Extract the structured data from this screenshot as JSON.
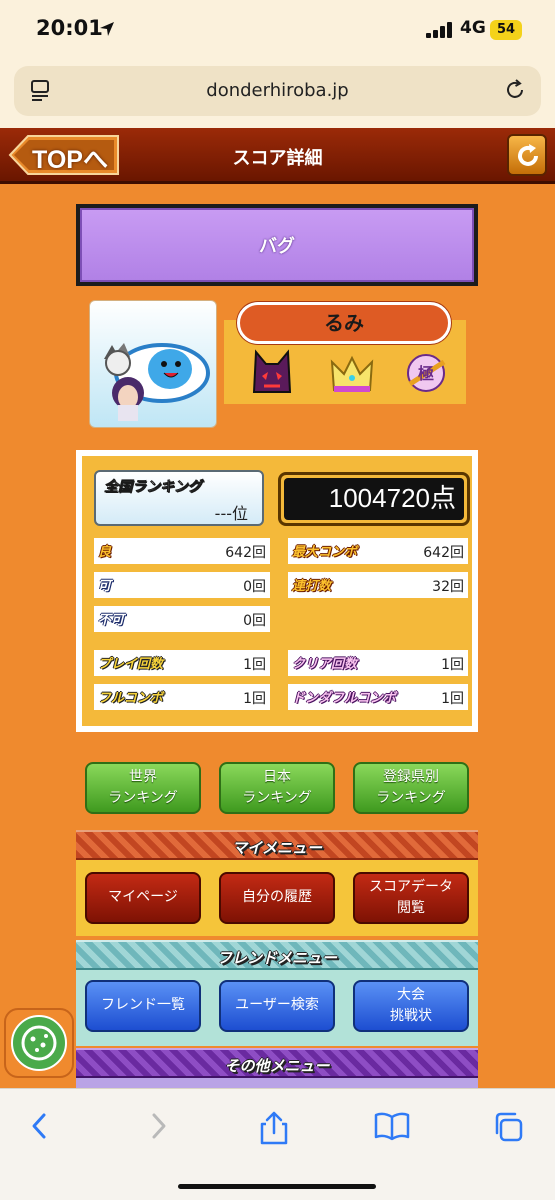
{
  "status_bar": {
    "time": "20:01",
    "network": "4G",
    "battery": "54"
  },
  "browser": {
    "url": "donderhiroba.jp"
  },
  "header": {
    "back_label": "TOPへ",
    "title": "スコア詳細"
  },
  "song": {
    "title": "バグ"
  },
  "player": {
    "name": "るみ",
    "badges": [
      "oni-difficulty-icon",
      "rainbow-crown-icon",
      "kiwami-rank-icon"
    ]
  },
  "score": {
    "ranking_label": "全国ランキング",
    "ranking_value": "---位",
    "total": "1004720点",
    "stats_left": [
      {
        "label": "良",
        "value": "642回"
      },
      {
        "label": "可",
        "value": "0回"
      },
      {
        "label": "不可",
        "value": "0回"
      }
    ],
    "stats_right": [
      {
        "label": "最大コンボ",
        "value": "642回"
      },
      {
        "label": "連打数",
        "value": "32回"
      }
    ],
    "play_count_label": "プレイ回数",
    "play_count": "1回",
    "clear_count_label": "クリア回数",
    "clear_count": "1回",
    "full_combo_label": "フルコンボ",
    "full_combo": "1回",
    "donda_full_combo_label": "ドンダフルコンボ",
    "donda_full_combo": "1回"
  },
  "ranking_buttons": {
    "world_1": "世界",
    "world_2": "ランキング",
    "japan_1": "日本",
    "japan_2": "ランキング",
    "pref_1": "登録県別",
    "pref_2": "ランキング"
  },
  "my_menu": {
    "header": "マイメニュー",
    "mypage": "マイページ",
    "history": "自分の履歴",
    "scoredata_1": "スコアデータ",
    "scoredata_2": "閲覧"
  },
  "friend_menu": {
    "header": "フレンドメニュー",
    "friend_list": "フレンド一覧",
    "user_search": "ユーザー検索",
    "challenge_1": "大会",
    "challenge_2": "挑戦状"
  },
  "other_menu": {
    "header": "その他メニュー"
  },
  "colors": {
    "page_bg": "#ef8a2e",
    "header_bg": "#8a2306",
    "song_panel": "#b98aeb",
    "green_button": "#5cb83a",
    "red_button": "#a21e0c",
    "blue_button": "#3a72e8"
  }
}
